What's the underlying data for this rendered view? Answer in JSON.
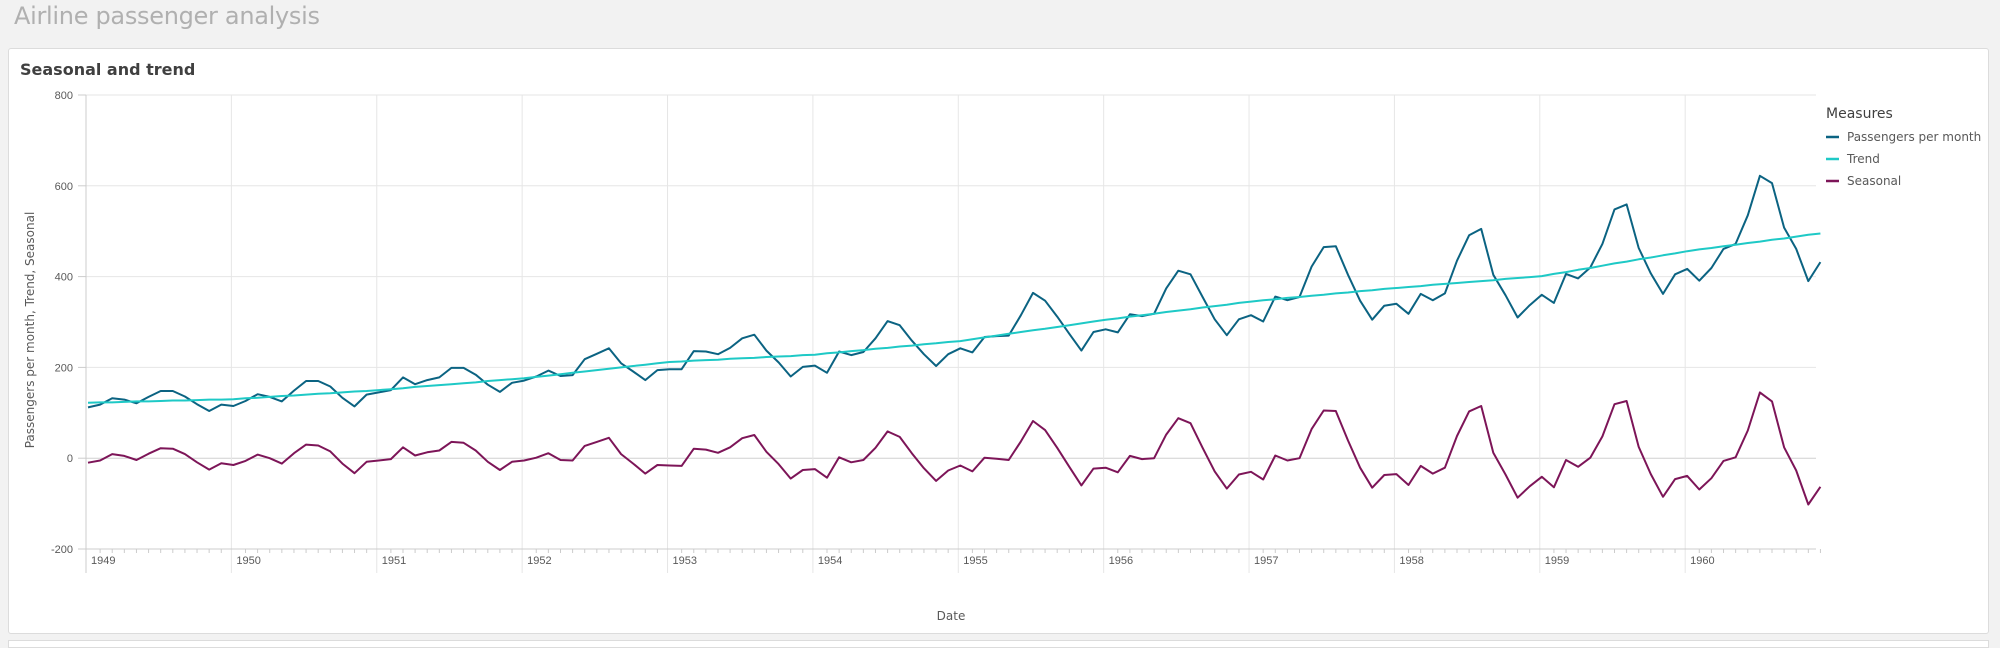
{
  "page": {
    "title": "Airline passenger analysis"
  },
  "card": {
    "title": "Seasonal and trend"
  },
  "colors": {
    "passengers": "#0b6382",
    "trend": "#1ec9c6",
    "seasonal": "#7d1558",
    "grid": "#e6e6e6",
    "axis": "#cccccc"
  },
  "chart_data": {
    "type": "line",
    "title": "Seasonal and trend",
    "xlabel": "Date",
    "ylabel": "Passengers per month, Trend, Seasonal",
    "ylim": [
      -200,
      800
    ],
    "yticks": [
      -200,
      0,
      200,
      400,
      600,
      800
    ],
    "ytick_labels": [
      "-200",
      "0",
      "200",
      "400",
      "600",
      "800"
    ],
    "xticks": [
      "1949",
      "1950",
      "1951",
      "1952",
      "1953",
      "1954",
      "1955",
      "1956",
      "1957",
      "1958",
      "1959",
      "1960"
    ],
    "x_start": "1949-01",
    "x_end": "1960-12",
    "x_frequency": "monthly",
    "grid": true,
    "legend": {
      "title": "Measures",
      "position": "right"
    },
    "series": [
      {
        "name": "Passengers per month",
        "color_key": "passengers",
        "values": [
          112,
          118,
          132,
          129,
          121,
          135,
          148,
          148,
          136,
          119,
          104,
          118,
          115,
          126,
          141,
          135,
          125,
          149,
          170,
          170,
          158,
          133,
          114,
          140,
          145,
          150,
          178,
          163,
          172,
          178,
          199,
          199,
          184,
          162,
          146,
          166,
          171,
          180,
          193,
          181,
          183,
          218,
          230,
          242,
          209,
          191,
          172,
          194,
          196,
          196,
          236,
          235,
          229,
          243,
          264,
          272,
          237,
          211,
          180,
          201,
          204,
          188,
          235,
          227,
          234,
          264,
          302,
          293,
          259,
          229,
          203,
          229,
          242,
          233,
          267,
          269,
          270,
          315,
          364,
          347,
          312,
          274,
          237,
          278,
          284,
          277,
          317,
          313,
          318,
          374,
          413,
          405,
          355,
          306,
          271,
          306,
          315,
          301,
          356,
          348,
          355,
          422,
          465,
          467,
          404,
          347,
          305,
          336,
          340,
          318,
          362,
          348,
          363,
          435,
          491,
          505,
          404,
          359,
          310,
          337,
          360,
          342,
          406,
          396,
          420,
          472,
          548,
          559,
          463,
          407,
          362,
          405,
          417,
          391,
          419,
          461,
          472,
          535,
          622,
          606,
          508,
          461,
          390,
          432
        ]
      },
      {
        "name": "Trend",
        "color_key": "trend",
        "values": [
          122,
          123,
          123,
          124,
          125,
          125,
          126,
          127,
          127,
          128,
          129,
          129,
          130,
          132,
          133,
          135,
          137,
          138,
          140,
          142,
          143,
          145,
          147,
          148,
          150,
          152,
          154,
          157,
          159,
          161,
          163,
          165,
          167,
          170,
          172,
          174,
          176,
          179,
          182,
          185,
          188,
          191,
          194,
          197,
          200,
          203,
          206,
          209,
          212,
          213,
          215,
          216,
          217,
          219,
          220,
          221,
          223,
          224,
          225,
          227,
          228,
          231,
          233,
          236,
          238,
          241,
          243,
          246,
          248,
          251,
          253,
          256,
          258,
          262,
          266,
          270,
          274,
          278,
          282,
          285,
          289,
          293,
          297,
          301,
          305,
          308,
          312,
          315,
          318,
          322,
          325,
          328,
          332,
          335,
          338,
          342,
          345,
          348,
          350,
          353,
          355,
          358,
          360,
          363,
          365,
          368,
          370,
          373,
          375,
          377,
          379,
          382,
          384,
          386,
          388,
          390,
          392,
          395,
          397,
          399,
          401,
          406,
          410,
          415,
          419,
          424,
          429,
          433,
          438,
          442,
          447,
          451,
          456,
          460,
          463,
          467,
          470,
          474,
          477,
          481,
          484,
          488,
          492,
          495
        ]
      },
      {
        "name": "Seasonal",
        "color_key": "seasonal",
        "values": [
          -10,
          -5,
          9,
          5,
          -4,
          10,
          22,
          21,
          9,
          -9,
          -25,
          -11,
          -15,
          -6,
          8,
          0,
          -12,
          11,
          30,
          28,
          15,
          -12,
          -33,
          -8,
          -5,
          -2,
          24,
          6,
          13,
          17,
          36,
          34,
          17,
          -8,
          -26,
          -8,
          -5,
          1,
          11,
          -4,
          -5,
          27,
          36,
          45,
          9,
          -12,
          -34,
          -15,
          -16,
          -17,
          21,
          19,
          12,
          24,
          44,
          51,
          14,
          -13,
          -45,
          -26,
          -24,
          -43,
          2,
          -9,
          -4,
          23,
          59,
          47,
          11,
          -22,
          -50,
          -27,
          -16,
          -29,
          1,
          -1,
          -4,
          37,
          82,
          62,
          23,
          -19,
          -60,
          -23,
          -21,
          -31,
          5,
          -2,
          0,
          52,
          88,
          77,
          23,
          -29,
          -67,
          -36,
          -30,
          -47,
          6,
          -5,
          0,
          64,
          105,
          104,
          39,
          -21,
          -65,
          -37,
          -35,
          -59,
          -17,
          -34,
          -21,
          49,
          103,
          115,
          12,
          -36,
          -87,
          -62,
          -41,
          -64,
          -4,
          -19,
          1,
          48,
          119,
          126,
          25,
          -35,
          -85,
          -46,
          -39,
          -69,
          -44,
          -6,
          2,
          61,
          145,
          125,
          24,
          -27,
          -102,
          -63
        ]
      }
    ]
  }
}
